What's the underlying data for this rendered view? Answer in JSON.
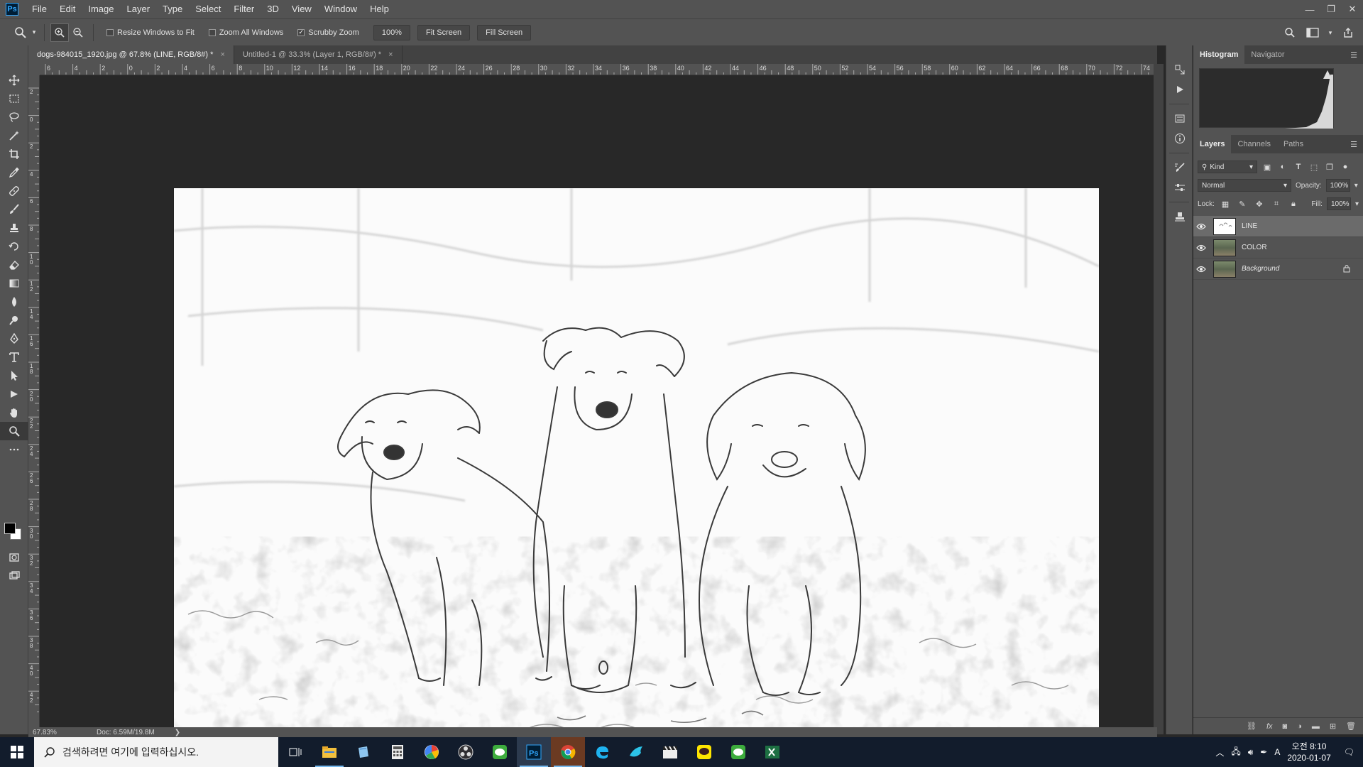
{
  "app": {
    "logo": "Ps"
  },
  "menu": [
    "File",
    "Edit",
    "Image",
    "Layer",
    "Type",
    "Select",
    "Filter",
    "3D",
    "View",
    "Window",
    "Help"
  ],
  "window_controls": {
    "minimize": "—",
    "restore": "❐",
    "close": "✕"
  },
  "options": {
    "resize_windows": "Resize Windows to Fit",
    "resize_windows_checked": false,
    "zoom_all_windows": "Zoom All Windows",
    "zoom_all_checked": false,
    "scrubby_zoom": "Scrubby Zoom",
    "scrubby_checked": true,
    "zoom_percent": "100%",
    "fit_screen": "Fit Screen",
    "fill_screen": "Fill Screen"
  },
  "tabs": [
    {
      "label": "dogs-984015_1920.jpg @ 67.8% (LINE, RGB/8#) *",
      "close": "×"
    },
    {
      "label": "Untitled-1 @ 33.3% (Layer 1, RGB/8#) *",
      "close": "×"
    }
  ],
  "ruler_top": [
    "6",
    "4",
    "2",
    "0",
    "2",
    "4",
    "6",
    "8",
    "10",
    "12",
    "14",
    "16",
    "18",
    "20",
    "22",
    "24",
    "26",
    "28",
    "30",
    "32",
    "34",
    "36",
    "38",
    "40",
    "42",
    "44",
    "46",
    "48",
    "50",
    "52",
    "54",
    "56",
    "58",
    "60",
    "62",
    "64",
    "66",
    "68",
    "70",
    "72",
    "74"
  ],
  "ruler_left": [
    "2",
    "0",
    "2",
    "4",
    "6",
    "8",
    "10",
    "12",
    "14",
    "16",
    "18",
    "20",
    "22",
    "24",
    "26",
    "28",
    "30",
    "32",
    "34",
    "36",
    "38",
    "40",
    "42"
  ],
  "status": {
    "zoom": "67.83%",
    "doc": "Doc: 6.59M/19.8M",
    "arrow": "❯"
  },
  "panels": {
    "top_tabs": [
      "Histogram",
      "Navigator"
    ],
    "layer_tabs": [
      "Layers",
      "Channels",
      "Paths"
    ],
    "kind": "Kind",
    "blend_mode": "Normal",
    "opacity_label": "Opacity:",
    "opacity_value": "100%",
    "lock_label": "Lock:",
    "fill_label": "Fill:",
    "fill_value": "100%",
    "layers": [
      {
        "name": "LINE",
        "selected": true,
        "italic": false,
        "locked": false
      },
      {
        "name": "COLOR",
        "selected": false,
        "italic": false,
        "locked": false
      },
      {
        "name": "Background",
        "selected": false,
        "italic": true,
        "locked": true
      }
    ]
  },
  "taskbar": {
    "search_placeholder": "검색하려면 여기에 입력하십시오.",
    "clock_time": "오전 8:10",
    "clock_date": "2020-01-07",
    "ime": "A",
    "apps": [
      "task-view",
      "file-explorer",
      "notepad",
      "calculator",
      "photos",
      "obs",
      "kakao-green",
      "photoshop",
      "chrome",
      "edge",
      "kakao-bird",
      "clapper",
      "kakaotalk",
      "kakao-green-2",
      "excel"
    ]
  }
}
